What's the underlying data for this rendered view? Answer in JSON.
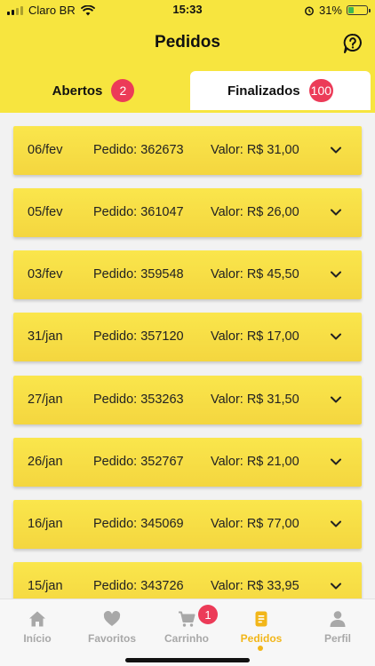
{
  "status_bar": {
    "carrier": "Claro BR",
    "time": "15:33",
    "battery": "31%",
    "battery_level": 0.31
  },
  "header": {
    "title": "Pedidos"
  },
  "tabs": [
    {
      "label": "Abertos",
      "count": "2"
    },
    {
      "label": "Finalizados",
      "count": "100"
    }
  ],
  "orders": [
    {
      "date": "06/fev",
      "order": "Pedido: 362673",
      "value": "Valor: R$ 31,00"
    },
    {
      "date": "05/fev",
      "order": "Pedido: 361047",
      "value": "Valor: R$ 26,00"
    },
    {
      "date": "03/fev",
      "order": "Pedido: 359548",
      "value": "Valor: R$ 45,50"
    },
    {
      "date": "31/jan",
      "order": "Pedido: 357120",
      "value": "Valor: R$ 17,00"
    },
    {
      "date": "27/jan",
      "order": "Pedido: 353263",
      "value": "Valor: R$ 31,50"
    },
    {
      "date": "26/jan",
      "order": "Pedido: 352767",
      "value": "Valor: R$ 21,00"
    },
    {
      "date": "16/jan",
      "order": "Pedido: 345069",
      "value": "Valor: R$ 77,00"
    },
    {
      "date": "15/jan",
      "order": "Pedido: 343726",
      "value": "Valor: R$ 33,95"
    }
  ],
  "bottom_nav": [
    {
      "label": "Início",
      "icon": "home-icon"
    },
    {
      "label": "Favoritos",
      "icon": "heart-icon"
    },
    {
      "label": "Carrinho",
      "icon": "cart-icon",
      "badge": "1"
    },
    {
      "label": "Pedidos",
      "icon": "receipt-icon",
      "active": true
    },
    {
      "label": "Perfil",
      "icon": "person-icon"
    }
  ],
  "colors": {
    "header_bg": "#f7e53f",
    "badge": "#ec3b58",
    "active_nav": "#f2b619",
    "row_bg": "#f7df45"
  }
}
